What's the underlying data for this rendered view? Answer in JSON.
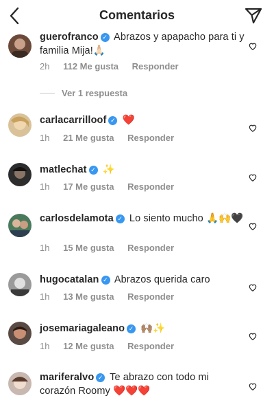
{
  "header": {
    "title": "Comentarios"
  },
  "comments": [
    {
      "user": "guerofranco",
      "text": "Abrazos y apapacho para ti y familia Mija!🙏🏻",
      "time": "2h",
      "likes": "112 Me gusta",
      "reply": "Responder",
      "view_replies": "Ver 1 respuesta"
    },
    {
      "user": "carlacarrilloof",
      "text": "❤️",
      "time": "1h",
      "likes": "21 Me gusta",
      "reply": "Responder"
    },
    {
      "user": "matlechat",
      "text": "✨",
      "time": "1h",
      "likes": "17 Me gusta",
      "reply": "Responder"
    },
    {
      "user": "carlosdelamota",
      "text": "Lo siento mucho 🙏🙌🖤",
      "time": "1h",
      "likes": "15 Me gusta",
      "reply": "Responder"
    },
    {
      "user": "hugocatalan",
      "text": "Abrazos querida caro",
      "time": "1h",
      "likes": "13 Me gusta",
      "reply": "Responder"
    },
    {
      "user": "josemariagaleano",
      "text": "🙌🏽✨",
      "time": "1h",
      "likes": "12 Me gusta",
      "reply": "Responder"
    },
    {
      "user": "mariferalvo",
      "text": "Te abrazo con todo mi corazón Roomy ❤️❤️❤️",
      "time": "",
      "likes": "",
      "reply": ""
    }
  ],
  "icons": {
    "back": "chevron-left-icon",
    "send": "paper-plane-icon",
    "like": "heart-outline-icon",
    "verified": "verified-badge-icon"
  },
  "colors": {
    "verified": "#3897f0",
    "meta": "#8e8e8e",
    "text": "#262626"
  }
}
